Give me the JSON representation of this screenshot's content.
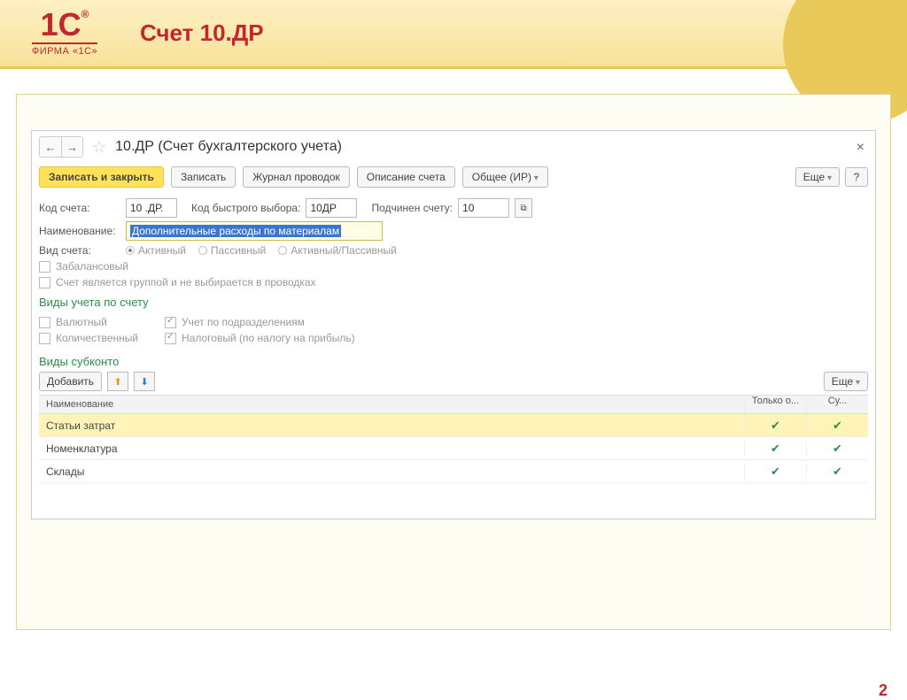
{
  "slide": {
    "title": "Счет 10.ДР",
    "logo_sub": "ФИРМА «1С»",
    "page_number": "2"
  },
  "form": {
    "title": "10.ДР (Счет бухгалтерского учета)",
    "toolbar": {
      "save_close": "Записать и закрыть",
      "save": "Записать",
      "journal": "Журнал проводок",
      "desc": "Описание счета",
      "general": "Общее (ИР)",
      "more": "Еще",
      "help": "?"
    },
    "fields": {
      "code_lbl": "Код счета:",
      "code_val": "10 .ДР.",
      "quick_lbl": "Код быстрого выбора:",
      "quick_val": "10ДР",
      "parent_lbl": "Подчинен счету:",
      "parent_val": "10",
      "name_lbl": "Наименование:",
      "name_val": "Дополнительные расходы по материалам",
      "type_lbl": "Вид счета:",
      "type_active": "Активный",
      "type_passive": "Пассивный",
      "type_both": "Активный/Пассивный",
      "offbalance": "Забалансовый",
      "group": "Счет является группой и не выбирается в проводках"
    },
    "section_accounting": "Виды учета по счету",
    "accounting": {
      "currency": "Валютный",
      "qty": "Количественный",
      "dept": "Учет по подразделениям",
      "tax": "Налоговый (по налогу на прибыль)"
    },
    "section_subkonto": "Виды субконто",
    "subkonto_bar": {
      "add": "Добавить",
      "more": "Еще"
    },
    "table": {
      "col_name": "Наименование",
      "col_only": "Только о...",
      "col_sum": "Су...",
      "rows": [
        {
          "name": "Статьи затрат",
          "only": true,
          "sum": true,
          "selected": true
        },
        {
          "name": "Номенклатура",
          "only": true,
          "sum": true,
          "selected": false
        },
        {
          "name": "Склады",
          "only": true,
          "sum": true,
          "selected": false
        }
      ]
    }
  }
}
